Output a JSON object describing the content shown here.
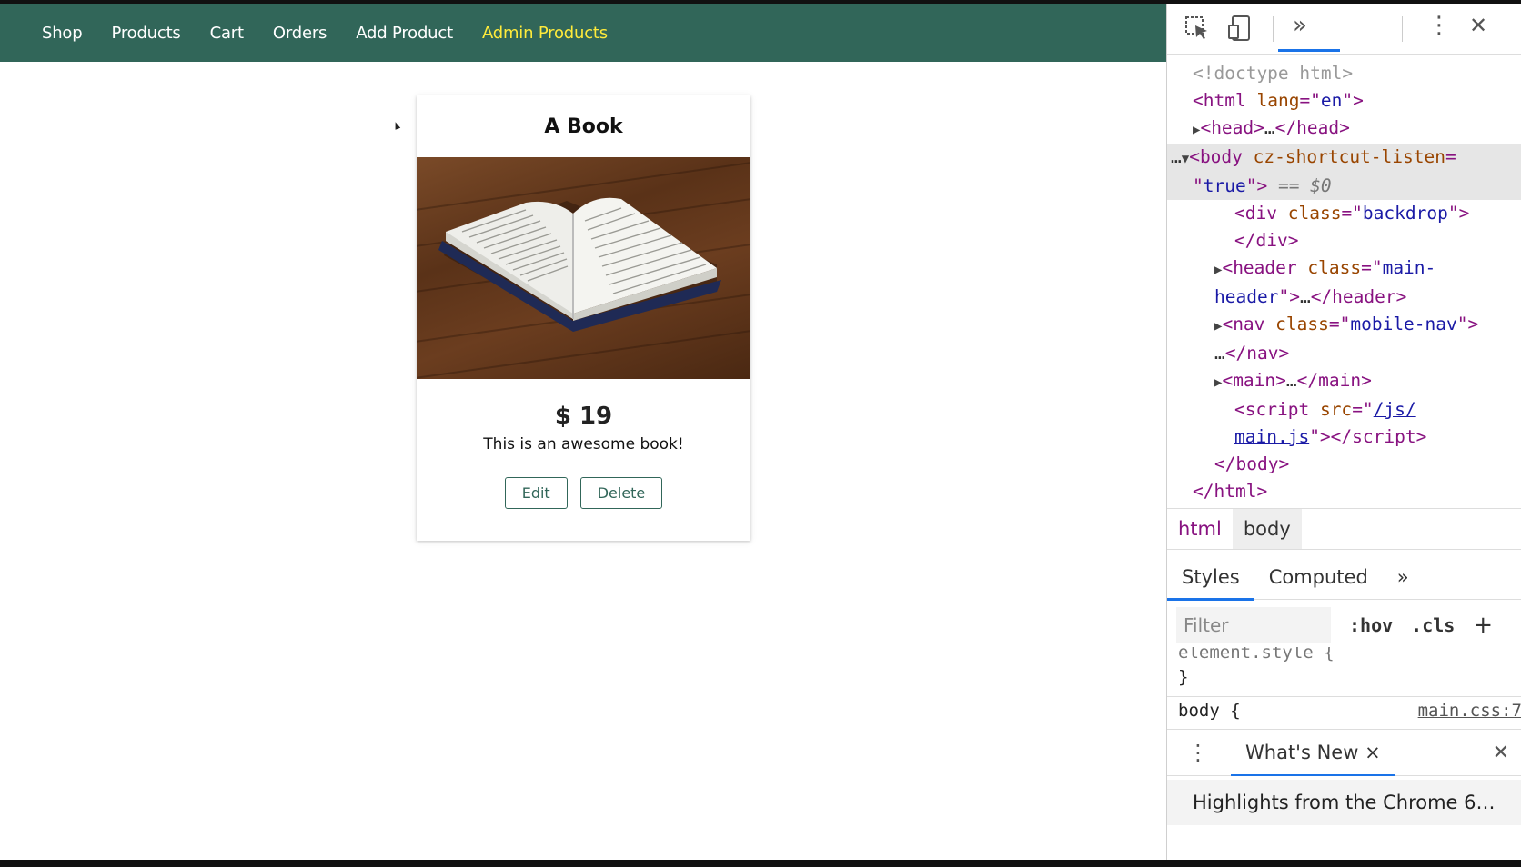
{
  "nav": {
    "items": [
      {
        "label": "Shop",
        "active": false
      },
      {
        "label": "Products",
        "active": false
      },
      {
        "label": "Cart",
        "active": false
      },
      {
        "label": "Orders",
        "active": false
      },
      {
        "label": "Add Product",
        "active": false
      },
      {
        "label": "Admin Products",
        "active": true
      }
    ],
    "header_color": "#316659",
    "active_color": "#ffeb3b"
  },
  "product": {
    "title": "A Book",
    "price": "$ 19",
    "description": "This is an awesome book!",
    "image_icon": "open-book-photo",
    "edit_label": "Edit",
    "delete_label": "Delete"
  },
  "devtools": {
    "toolbar": {
      "inspect_icon": "inspect-element-icon",
      "device_icon": "device-toolbar-icon",
      "more_tabs": "»",
      "menu_icon": "⋮",
      "close_icon": "✕"
    },
    "dom": {
      "doctype": "<!doctype html>",
      "html_open_tag": "html",
      "html_lang_attr": "lang",
      "html_lang_val": "en",
      "head_tag": "head",
      "head_ellipsis": "…",
      "body_tag": "body",
      "body_attr": "cz-shortcut-listen",
      "body_attr_val": "true",
      "body_marker": "== $0",
      "div_tag": "div",
      "div_class_attr": "class",
      "div_class_val": "backdrop",
      "header_tag": "header",
      "header_class_val_1": "main-",
      "header_class_val_2": "header",
      "nav_tag": "nav",
      "nav_class_val": "mobile-nav",
      "main_tag": "main",
      "script_tag": "script",
      "script_src_attr": "src",
      "script_src_1": "/js/",
      "script_src_2": "main.js",
      "close_body": "</body>",
      "close_html": "</html>"
    },
    "breadcrumbs": [
      "html",
      "body"
    ],
    "styles_tabs": [
      "Styles",
      "Computed",
      "»"
    ],
    "filter_placeholder": "Filter",
    "hov_label": ":hov",
    "cls_label": ".cls",
    "plus_label": "+",
    "rules": {
      "element_style": "element.style {",
      "close_brace": "}",
      "body_selector": "body {",
      "body_source": "main.css:7"
    },
    "drawer": {
      "tab_label": "What's New",
      "tab_close": "×",
      "close_icon": "✕",
      "highlights_text": "Highlights from the Chrome 6…"
    }
  }
}
